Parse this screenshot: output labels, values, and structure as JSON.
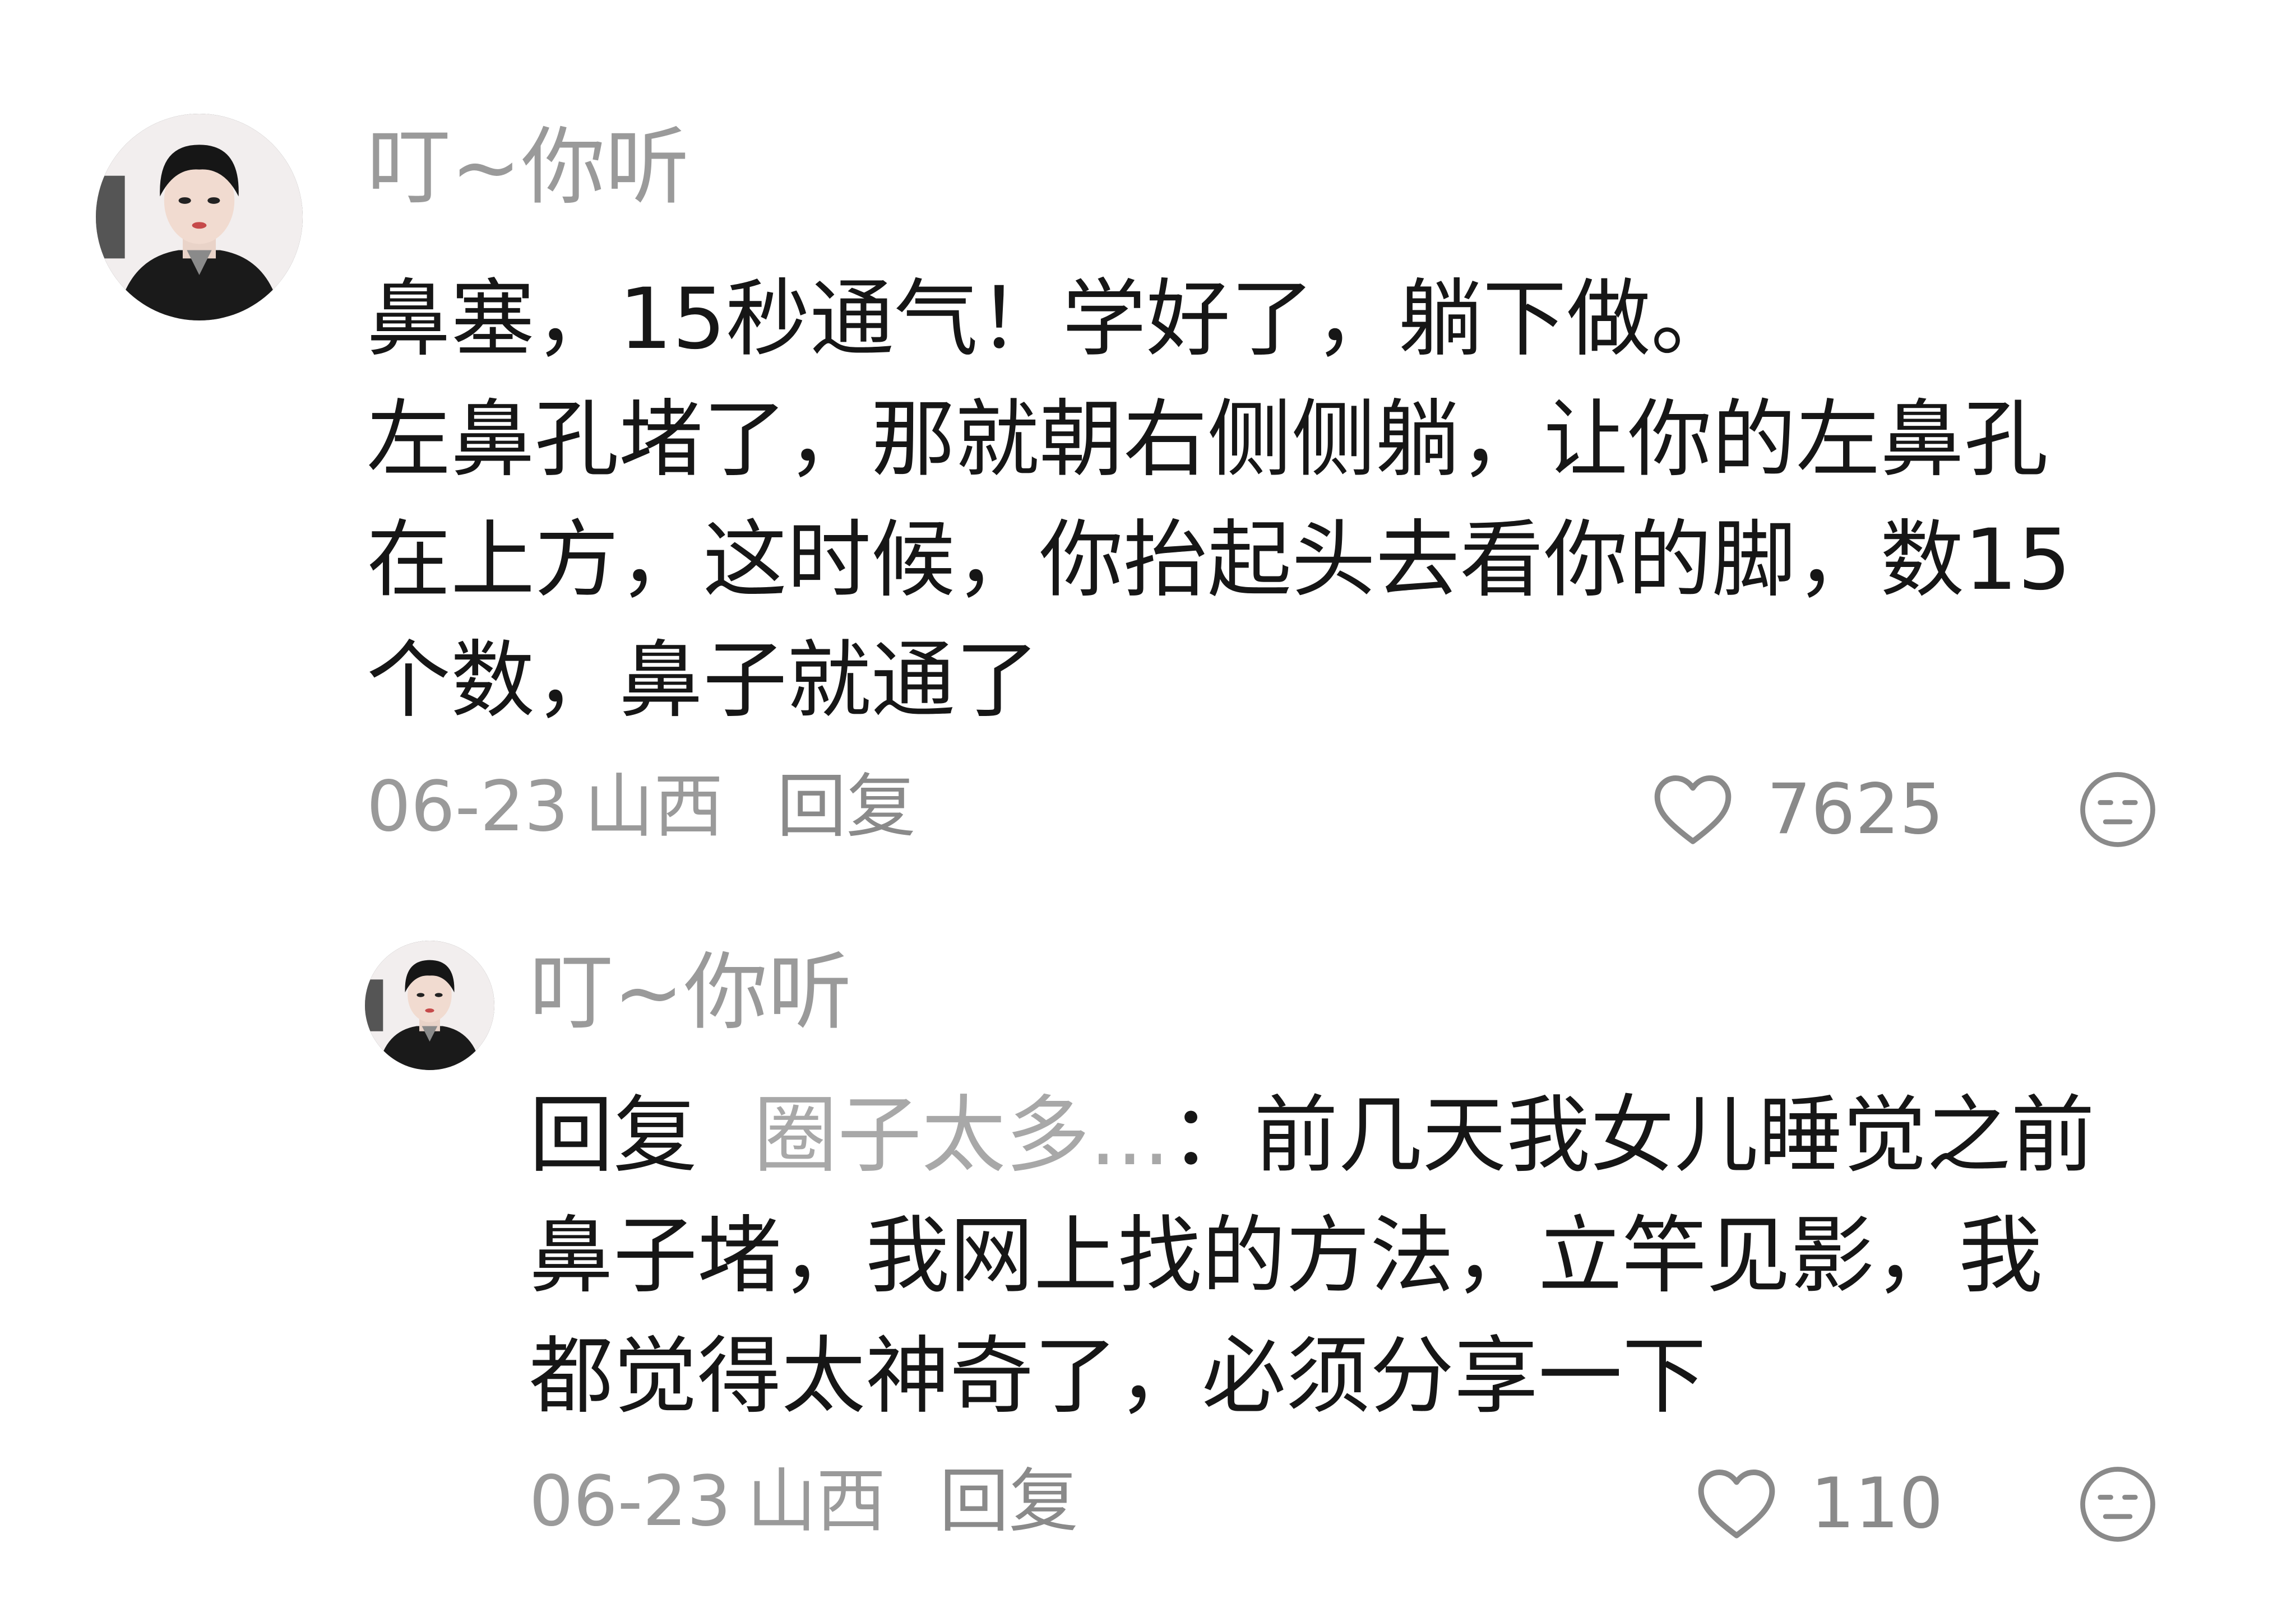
{
  "comment": {
    "username": "叮~你听",
    "text_lines": [
      "鼻塞，15秒通气！学好了，躺下做。",
      "左鼻孔堵了，那就朝右侧侧躺，让你的左鼻孔",
      "在上方，这时候，你抬起头去看你的脚，数15",
      "个数，鼻子就通了"
    ],
    "date": "06-23",
    "location": "山西",
    "reply_label": "回复",
    "like_count": "7625"
  },
  "reply": {
    "username": "叮~你听",
    "prefix": "回复",
    "target": "圈子太多...",
    "colon": "：",
    "text_first": "前几天我女儿睡觉之前",
    "text_lines": [
      "鼻子堵，我网上找的方法，立竿见影，我",
      "都觉得太神奇了，必须分享一下"
    ],
    "date": "06-23",
    "location": "山西",
    "reply_label": "回复",
    "like_count": "110"
  },
  "icons": {
    "like": "heart-outline-icon",
    "dislike": "unamused-face-icon"
  },
  "colors": {
    "text": "#161616",
    "muted": "#9a9a9a",
    "background": "#ffffff"
  }
}
